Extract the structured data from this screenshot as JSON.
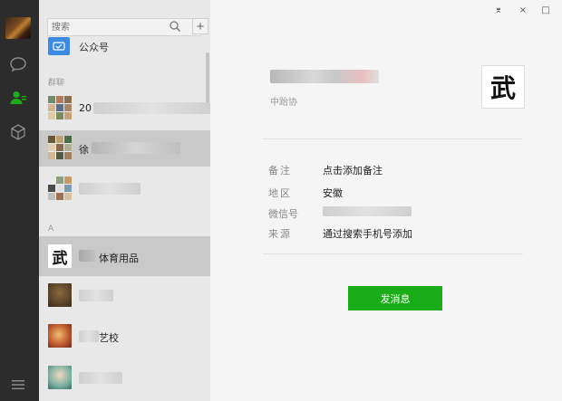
{
  "search": {
    "placeholder": "搜索"
  },
  "add_button": {
    "label": "+"
  },
  "contacts": {
    "top_item_label": "公众号",
    "group_section_label": "群聊",
    "groups": [
      {
        "name_prefix": "20"
      },
      {
        "name_prefix": "徐"
      },
      {
        "name_prefix": ""
      }
    ],
    "letter_section_label": "A",
    "people": [
      {
        "name": "体育用品"
      },
      {
        "name": ""
      },
      {
        "name": "艺校"
      },
      {
        "name": ""
      }
    ]
  },
  "profile": {
    "region_line": "中跆协",
    "avatar_glyph": "武",
    "fields": [
      {
        "label": "备注",
        "value": "点击添加备注"
      },
      {
        "label": "地区",
        "value": "安徽"
      },
      {
        "label": "微信号",
        "value": ""
      },
      {
        "label": "来源",
        "value": "通过搜索手机号添加"
      }
    ],
    "send_button_label": "发消息"
  },
  "window_controls": {
    "pin": "⌆",
    "close": "×",
    "maximize": "□"
  },
  "colors": {
    "accent_green": "#1aad19",
    "rail_bg": "#2c2c2c",
    "active_contacts_icon": "#1aad19"
  }
}
